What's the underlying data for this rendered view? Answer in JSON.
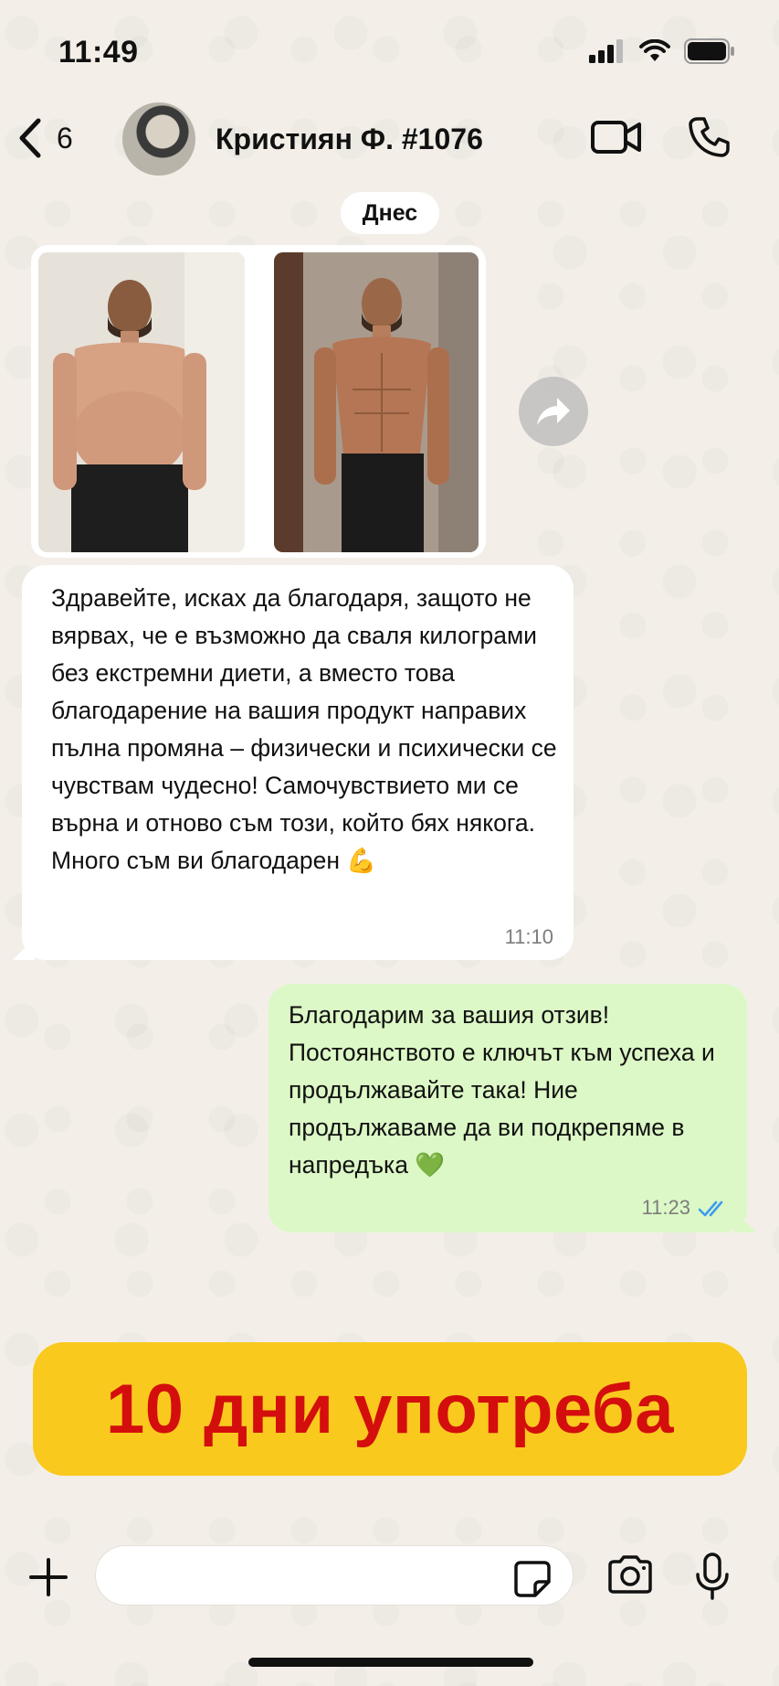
{
  "status_bar": {
    "time": "11:49"
  },
  "header": {
    "back_count": "6",
    "contact_name": "Кристиян Ф. #1076"
  },
  "chat": {
    "date_label": "Днес",
    "incoming": {
      "text": "Здравейте, исках да благодаря, защото не вярвах, че е възможно да сваля килограми без екстремни диети, а вместо това благодарение на вашия продукт направих пълна промяна – физически и психически се чувствам чудесно! Самочувствието ми се върна и отново съм този, който бях някога. Много съм ви благодарен 💪",
      "time": "11:10"
    },
    "outgoing": {
      "text": "Благодарим за вашия отзив! Постоянството е ключът към успеха и продължавайте така! Ние продължаваме да ви подкрепяме в напредъка 💚",
      "time": "11:23",
      "read_color": "#3d9bf0"
    }
  },
  "banner": {
    "text": "10 дни употреба",
    "bg_color": "#f9c91e",
    "text_color": "#d40d0d"
  },
  "composer": {
    "placeholder": ""
  },
  "icons": [
    "back-chevron-icon",
    "video-icon",
    "phone-icon",
    "forward-icon",
    "plus-icon",
    "sticker-icon",
    "camera-icon",
    "mic-icon",
    "signal-icon",
    "wifi-icon",
    "battery-icon"
  ]
}
